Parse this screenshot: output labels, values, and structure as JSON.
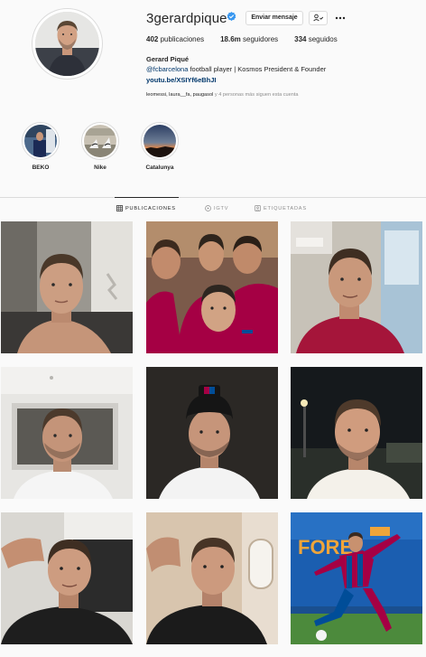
{
  "profile": {
    "username": "3gerardpique",
    "message_button": "Enviar mensaje",
    "posts_count": "402",
    "posts_label": "publicaciones",
    "followers_count": "18.6m",
    "followers_label": "seguidores",
    "following_count": "334",
    "following_label": "seguidos",
    "full_name": "Gerard Piqué",
    "bio_tag": "@fcbarcelona",
    "bio_text": " football player | Kosmos President & Founder",
    "link": "youtu.be/XSIYf6eBhJI",
    "followed_by_names": "leomessi, laura__fa, paugasol",
    "followed_by_rest": " y 4 personas más siguen esta cuenta"
  },
  "highlights": [
    {
      "label": "BEKO"
    },
    {
      "label": "Nike"
    },
    {
      "label": "Catalunya"
    }
  ],
  "tabs": [
    {
      "label": "PUBLICACIONES",
      "icon": "grid-icon",
      "active": true
    },
    {
      "label": "IGTV",
      "icon": "igtv-icon",
      "active": false
    },
    {
      "label": "ETIQUETADAS",
      "icon": "tagged-icon",
      "active": false
    }
  ],
  "posts": [
    {
      "name": "post-selfie-shirtless"
    },
    {
      "name": "post-group-selfie-barca"
    },
    {
      "name": "post-selfie-red-shirt"
    },
    {
      "name": "post-selfie-white-room"
    },
    {
      "name": "post-selfie-cap"
    },
    {
      "name": "post-selfie-night"
    },
    {
      "name": "post-selfie-lying"
    },
    {
      "name": "post-selfie-plane"
    },
    {
      "name": "post-match-action"
    }
  ],
  "colors": {
    "verified": "#3897f0",
    "link": "#00376b",
    "muted": "#8e8e8e",
    "border": "#dbdbdb",
    "barca_red": "#a50044",
    "barca_blue": "#004d98"
  }
}
